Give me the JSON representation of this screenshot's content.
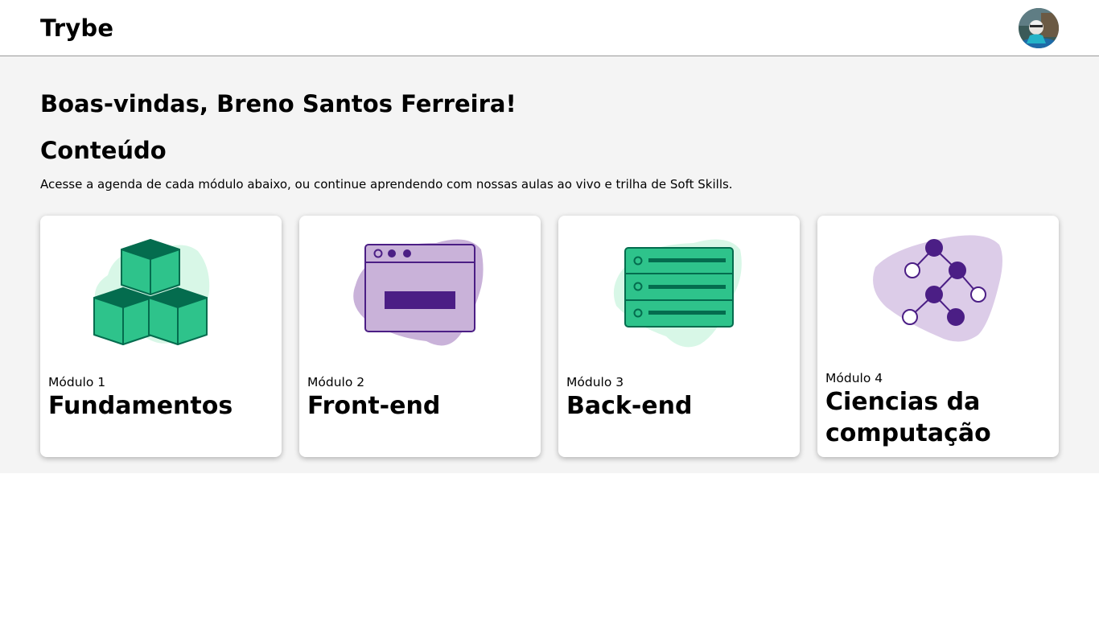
{
  "header": {
    "brand": "Trybe",
    "avatar_icon": "user-avatar"
  },
  "main": {
    "welcome": "Boas-vindas, Breno Santos Ferreira!",
    "section_title": "Conteúdo",
    "section_description": "Acesse a agenda de cada módulo abaixo, ou continue aprendendo com nossas aulas ao vivo e trilha de Soft Skills.",
    "modules": [
      {
        "label": "Módulo 1",
        "title": "Fundamentos",
        "icon": "cubes-icon",
        "accent": "#2ec38b",
        "blob": "#d8f7e7"
      },
      {
        "label": "Módulo 2",
        "title": "Front-end",
        "icon": "browser-window-icon",
        "accent": "#4b1e85",
        "blob": "#dccce8"
      },
      {
        "label": "Módulo 3",
        "title": "Back-end",
        "icon": "server-icon",
        "accent": "#2ec38b",
        "blob": "#d8f7e7"
      },
      {
        "label": "Módulo 4",
        "title": "Ciencias da computação",
        "icon": "tree-graph-icon",
        "accent": "#4b1e85",
        "blob": "#dccce8"
      }
    ]
  },
  "colors": {
    "page_background": "#f4f4f4",
    "card_background": "#ffffff",
    "green": "#2ec38b",
    "dark_green": "#046c4e",
    "purple": "#4b1e85",
    "light_purple": "#c9b2d9"
  }
}
